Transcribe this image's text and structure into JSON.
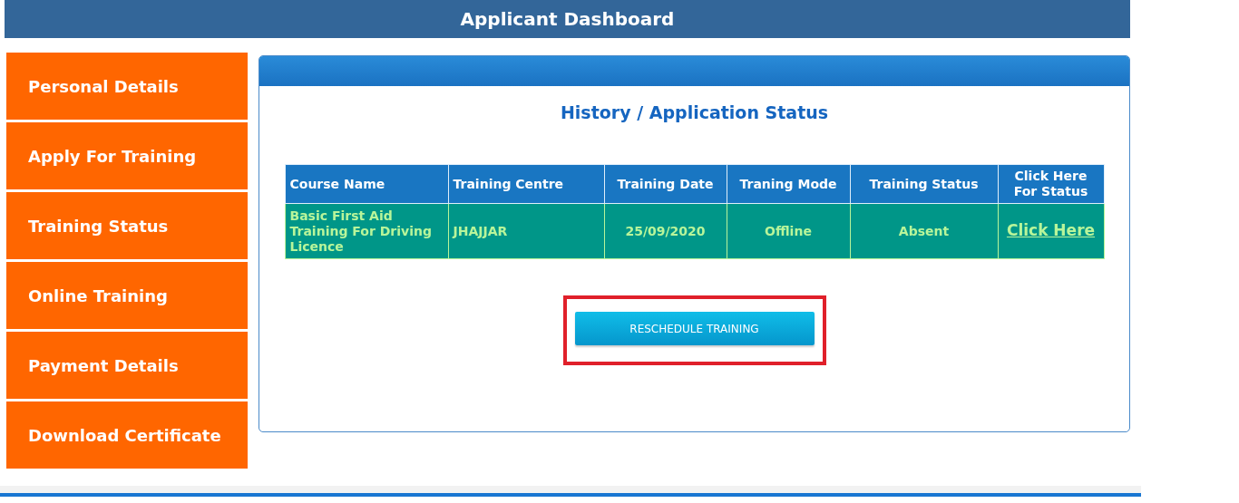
{
  "header": {
    "title": "Applicant Dashboard"
  },
  "sidebar": {
    "items": [
      {
        "label": "Personal Details"
      },
      {
        "label": "Apply For Training"
      },
      {
        "label": "Training Status"
      },
      {
        "label": "Online Training"
      },
      {
        "label": "Payment Details"
      },
      {
        "label": "Download Certificate"
      }
    ]
  },
  "panel": {
    "title": "History / Application Status",
    "table": {
      "columns": [
        "Course Name",
        "Training Centre",
        "Training Date",
        "Traning Mode",
        "Training Status",
        "Click Here For Status"
      ],
      "rows": [
        {
          "cells": [
            "Basic First Aid Training For Driving Licence",
            "JHAJJAR",
            "25/09/2020",
            "Offline",
            "Absent"
          ],
          "link": "Click Here"
        }
      ]
    },
    "button": "RESCHEDULE TRAINING"
  }
}
